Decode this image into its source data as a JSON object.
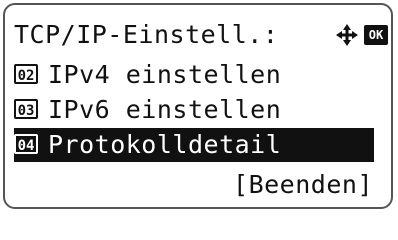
{
  "header": {
    "title": "TCP/IP-Einstell.:",
    "nav_icon": "four-way-arrow-icon",
    "ok_label": "OK"
  },
  "menu": {
    "items": [
      {
        "number": "02",
        "label": "IPv4 einstellen",
        "selected": false
      },
      {
        "number": "03",
        "label": "IPv6 einstellen",
        "selected": false
      },
      {
        "number": "04",
        "label": "Protokolldetail",
        "selected": true
      }
    ]
  },
  "footer": {
    "exit_label": "[Beenden]"
  },
  "colors": {
    "text": "#111111",
    "highlight_bg": "#111111",
    "highlight_text": "#ffffff",
    "background": "#ffffff"
  }
}
